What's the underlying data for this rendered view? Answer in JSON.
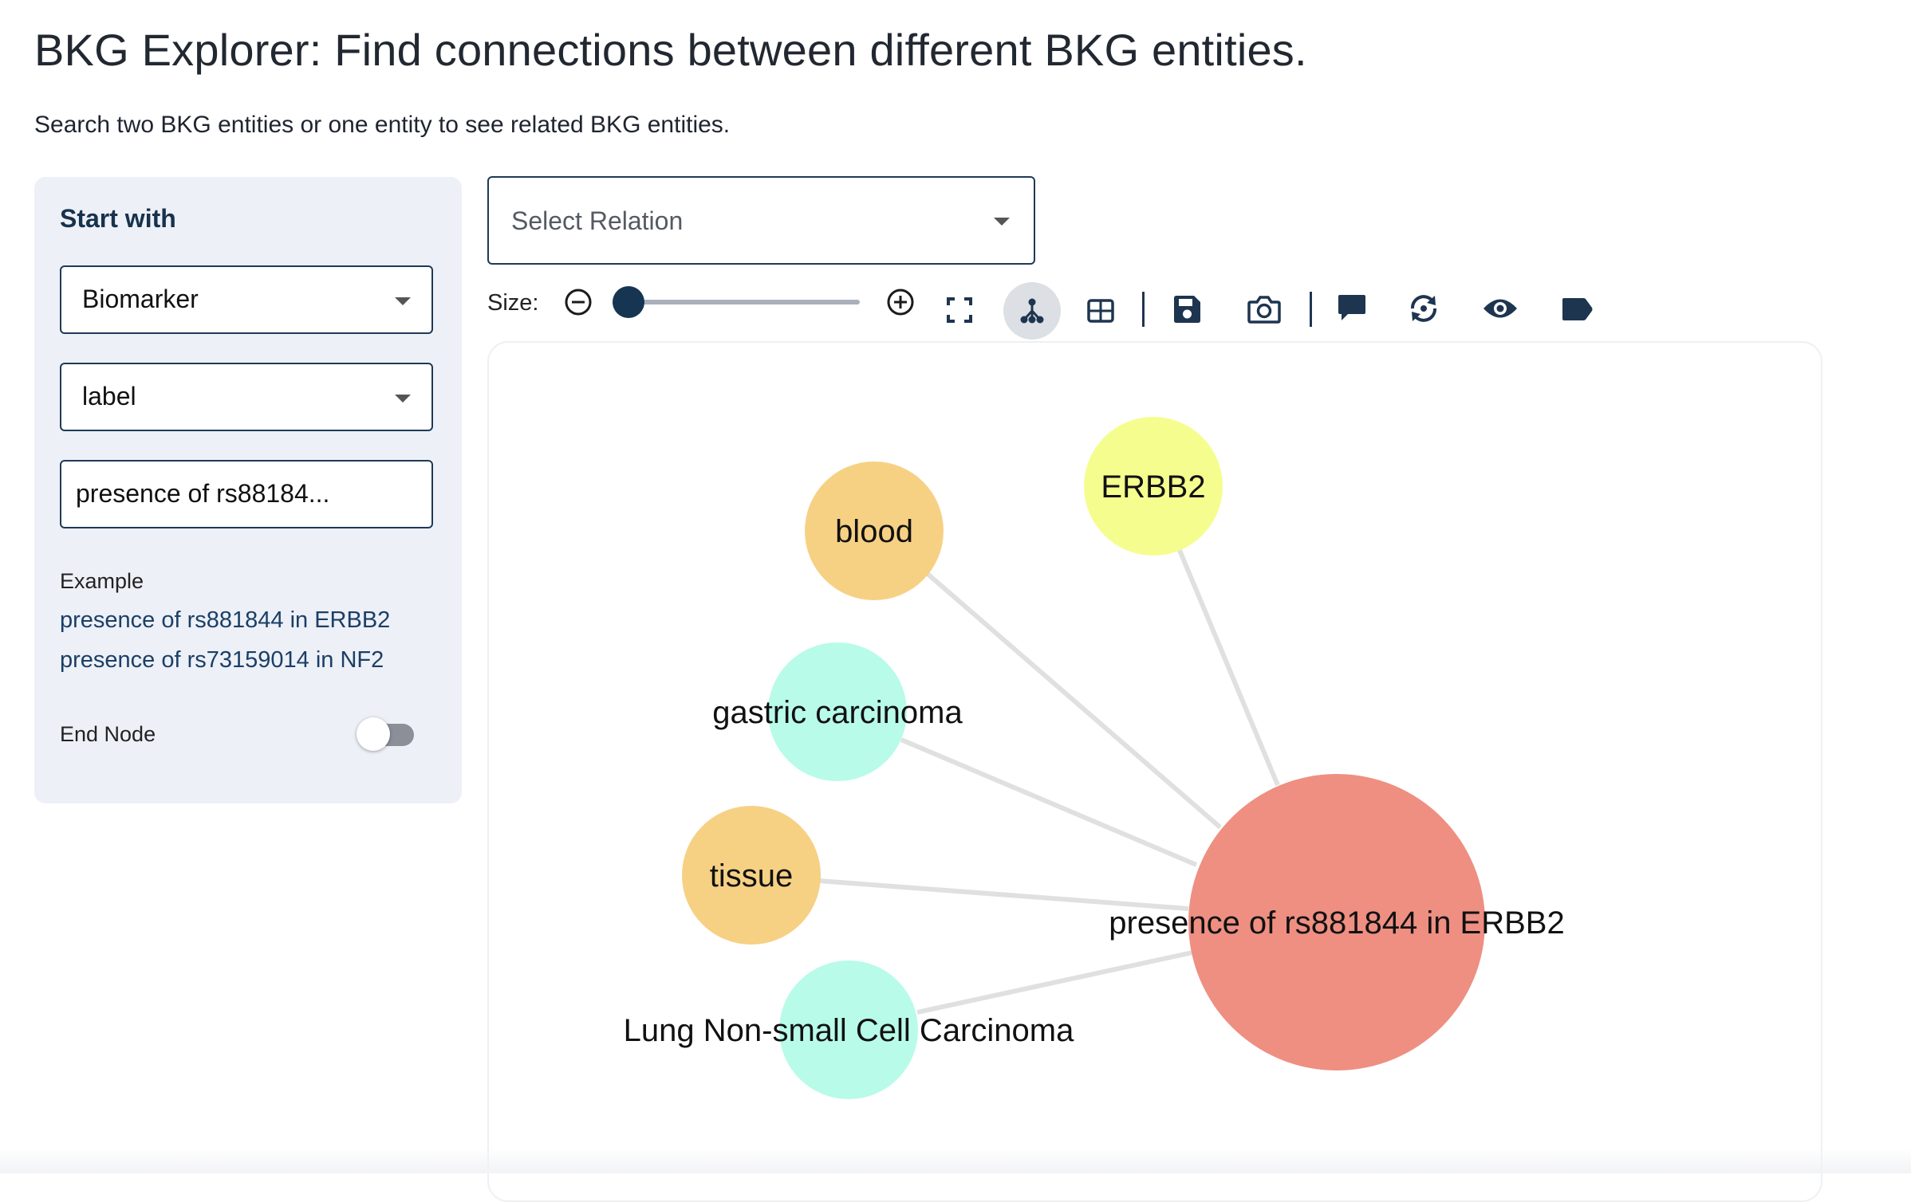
{
  "header": {
    "title": "BKG Explorer: Find connections between different BKG entities.",
    "subtitle": "Search two BKG entities or one entity to see related BKG entities."
  },
  "sidebar": {
    "title": "Start with",
    "entity_type": "Biomarker",
    "property": "label",
    "search_value": "presence of rs88184...",
    "example_label": "Example",
    "examples": [
      "presence of rs881844 in ERBB2",
      "presence of rs73159014 in NF2"
    ],
    "end_node_label": "End Node",
    "end_node_enabled": false
  },
  "relation_select": {
    "placeholder": "Select Relation"
  },
  "toolbar": {
    "size_label": "Size:",
    "icons": [
      "zoom-out-icon",
      "size-slider",
      "zoom-in-icon",
      "fullscreen-icon",
      "graph-view-icon",
      "table-view-icon",
      "save-icon",
      "camera-icon",
      "comment-icon",
      "refresh-icon",
      "eye-icon",
      "tag-icon"
    ],
    "active_view": "graph"
  },
  "graph": {
    "center": {
      "label": "presence of rs881844 in ERBB2",
      "color": "#ee8f82"
    },
    "nodes": [
      {
        "label": "blood",
        "color": "#f6d184"
      },
      {
        "label": "ERBB2",
        "color": "#f5fd8f"
      },
      {
        "label": "gastric carcinoma",
        "color": "#b8fbe8"
      },
      {
        "label": "tissue",
        "color": "#f6d184"
      },
      {
        "label": "Lung Non-small Cell Carcinoma",
        "color": "#b8fbe8"
      }
    ],
    "edge_color": "#e0e0e0"
  }
}
